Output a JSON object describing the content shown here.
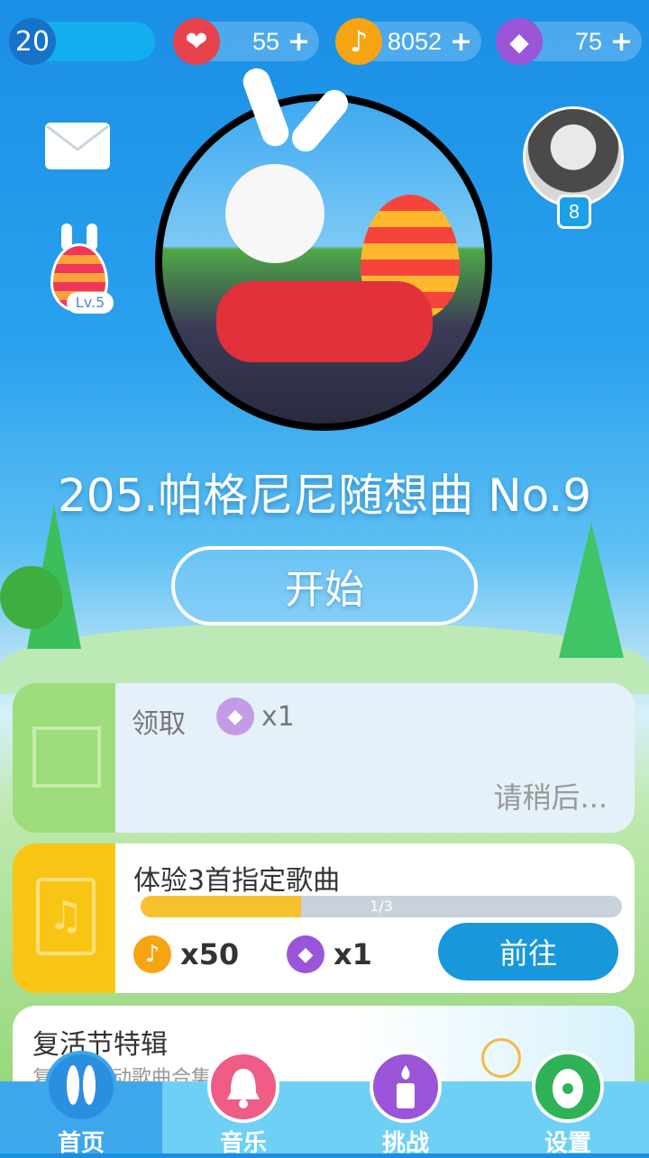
{
  "topbar": {
    "level": "20",
    "hearts": "55",
    "notes": "8052",
    "diamonds": "75",
    "plus": "+"
  },
  "avatar_badge": "8",
  "egg_level": "Lv.5",
  "song_title": "205.帕格尼尼随想曲 No.9",
  "start_label": "开始",
  "reward_card": {
    "claim_label": "领取",
    "amount": "x1",
    "wait_label": "请稍后..."
  },
  "task_card": {
    "title": "体验3首指定歌曲",
    "progress": 0.333,
    "progress_label": "1/3",
    "note_reward": "x50",
    "diamond_reward": "x1",
    "go_label": "前往"
  },
  "event_card": {
    "title": "复活节特辑",
    "subtitle": "复活节活动歌曲合集"
  },
  "nav": [
    {
      "label": "首页",
      "icon": "bunny-ears-icon"
    },
    {
      "label": "音乐",
      "icon": "bell-icon"
    },
    {
      "label": "挑战",
      "icon": "candle-icon"
    },
    {
      "label": "设置",
      "icon": "easter-egg-icon"
    }
  ],
  "colors": {
    "heart": "#e8424f",
    "note": "#f6a412",
    "diamond": "#9a55d8",
    "accent": "#1898da"
  }
}
